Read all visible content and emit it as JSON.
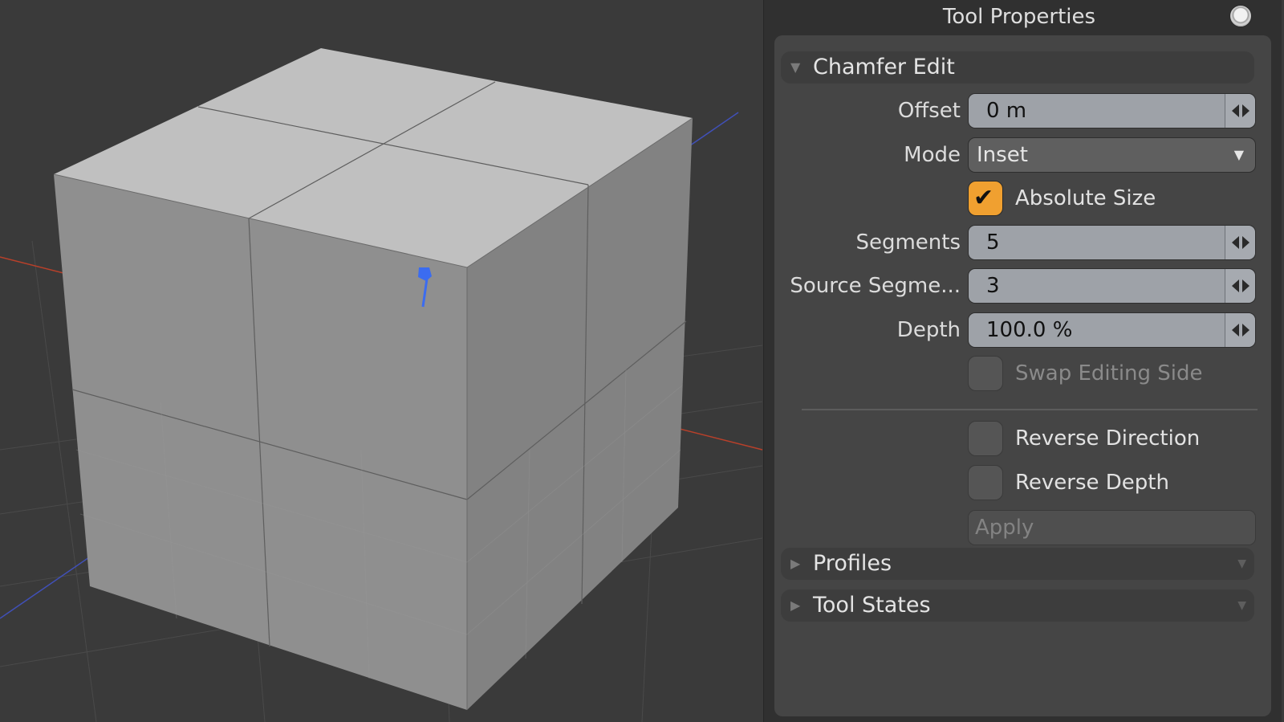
{
  "panel": {
    "title": "Tool Properties"
  },
  "chamfer": {
    "header": "Chamfer Edit",
    "offset": {
      "label": "Offset",
      "value": "0 m"
    },
    "mode": {
      "label": "Mode",
      "value": "Inset"
    },
    "absolute_size": {
      "label": "Absolute Size",
      "checked": true
    },
    "segments": {
      "label": "Segments",
      "value": "5"
    },
    "source_segments": {
      "label": "Source Segme...",
      "value": "3"
    },
    "depth": {
      "label": "Depth",
      "value": "100.0 %"
    },
    "swap_editing_side": {
      "label": "Swap Editing Side",
      "checked": false
    },
    "reverse_direction": {
      "label": "Reverse Direction",
      "checked": false
    },
    "reverse_depth": {
      "label": "Reverse Depth",
      "checked": false
    },
    "apply_label": "Apply"
  },
  "sections": {
    "profiles": "Profiles",
    "tool_states": "Tool States"
  },
  "colors": {
    "accent": "#f0a030",
    "viewport_bg": "#3a3a3a",
    "mesh_top": "#c0c0c0",
    "mesh_front": "#8e8e8e",
    "axis_x": "#b8402a",
    "axis_z": "#4050b8",
    "handle": "#3b6cf0"
  },
  "icons": {
    "title_button": "circle-button-icon",
    "expand": "triangle-down-icon",
    "collapse": "triangle-right-icon",
    "spin": "spin-arrows-icon",
    "dropdown": "caret-down-icon",
    "check": "checkmark-icon"
  }
}
